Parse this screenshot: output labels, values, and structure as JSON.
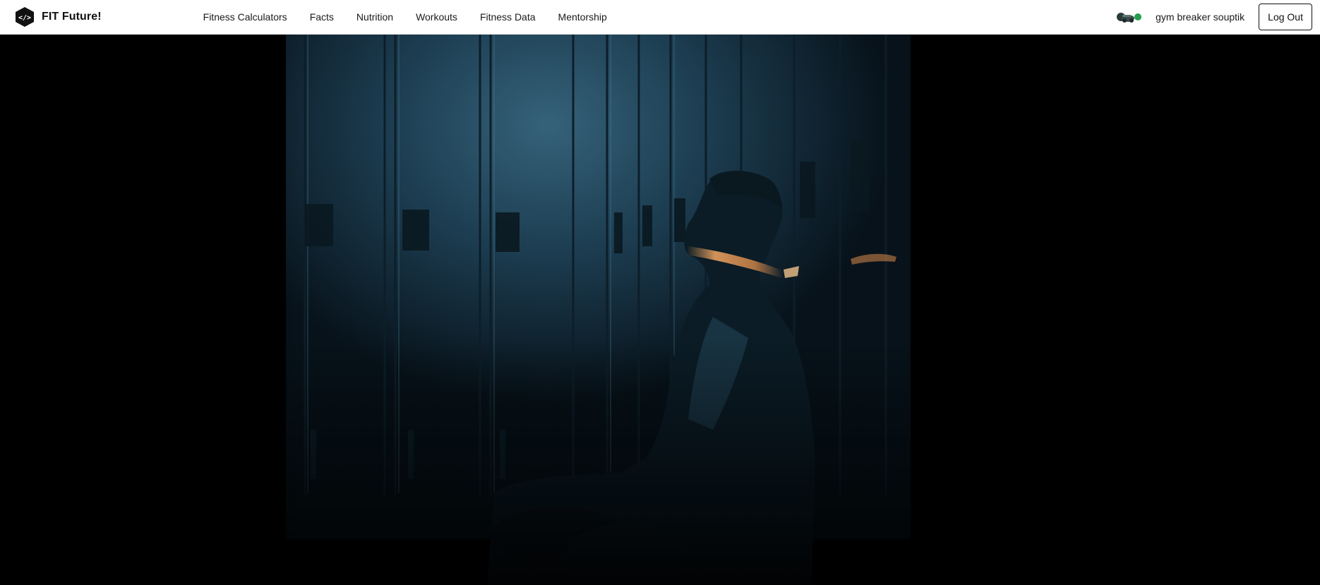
{
  "brand": {
    "name": "FIT Future!",
    "logo_icon": "code-hexagon-icon"
  },
  "nav": {
    "links": [
      {
        "label": "Fitness Calculators"
      },
      {
        "label": "Facts"
      },
      {
        "label": "Nutrition"
      },
      {
        "label": "Workouts"
      },
      {
        "label": "Fitness Data"
      },
      {
        "label": "Mentorship"
      }
    ]
  },
  "user": {
    "name": "gym breaker souptik",
    "avatar_icon": "user-avatar-icon",
    "status": "online",
    "status_color": "#22a04a"
  },
  "actions": {
    "logout_label": "Log Out"
  },
  "hero": {
    "image": "man-sitting-in-dark-locker-room-photo",
    "dominant_colors": [
      "#000000",
      "#1b3a4c",
      "#2f5a70",
      "#d98a4a"
    ]
  }
}
